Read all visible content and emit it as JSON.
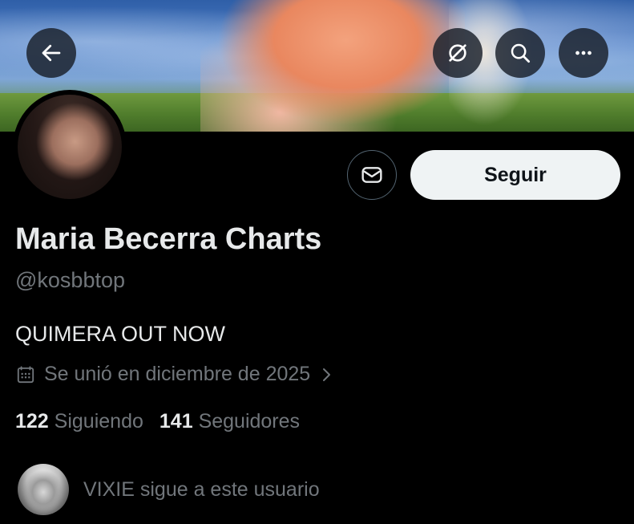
{
  "header": {
    "back_icon": "arrow-left-icon",
    "actions": [
      "hide-icon",
      "search-icon",
      "more-icon"
    ]
  },
  "profile": {
    "display_name": "Maria Becerra Charts",
    "handle": "@kosbbtop",
    "bio": "QUIMERA OUT NOW",
    "joined": "Se unió en diciembre de 2025",
    "following_count": "122",
    "following_label": "Siguiendo",
    "followers_count": "141",
    "followers_label": "Seguidores"
  },
  "actions": {
    "follow_label": "Seguir",
    "message_icon": "message-icon"
  },
  "followed_by": {
    "text": "VIXIE sigue a este usuario"
  },
  "colors": {
    "background": "#000000",
    "primary_text": "#e7e9ea",
    "secondary_text": "#71767b",
    "follow_button_bg": "#eff3f4",
    "follow_button_text": "#0f1419"
  }
}
